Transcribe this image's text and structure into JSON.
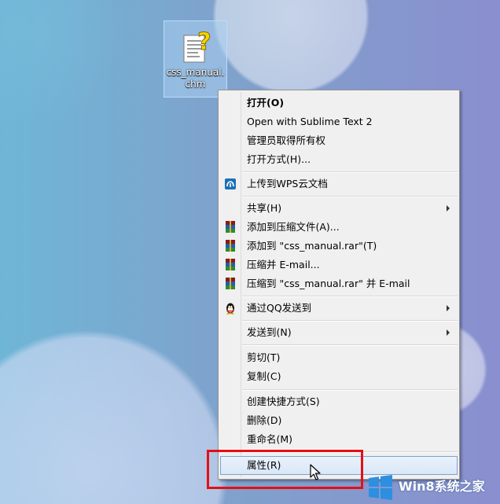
{
  "desktop": {
    "file_icon_name": "chm-help-file-icon",
    "file_label": "css_manual.chm"
  },
  "context_menu": {
    "open": "打开(O)",
    "open_with_sublime": "Open with Sublime Text 2",
    "take_ownership": "管理员取得所有权",
    "open_with": "打开方式(H)...",
    "upload_wps": "上传到WPS云文档",
    "share": "共享(H)",
    "add_to_archive": "添加到压缩文件(A)...",
    "add_to_rar": "添加到 \"css_manual.rar\"(T)",
    "compress_email": "压缩并 E-mail...",
    "compress_rar_email": "压缩到 \"css_manual.rar\" 并 E-mail",
    "send_via_qq": "通过QQ发送到",
    "send_to": "发送到(N)",
    "cut": "剪切(T)",
    "copy": "复制(C)",
    "create_shortcut": "创建快捷方式(S)",
    "delete": "删除(D)",
    "rename": "重命名(M)",
    "properties": "属性(R)"
  },
  "colors": {
    "highlight_box": "#e60f14",
    "menu_background": "#f0f0f0",
    "hover_border": "#7da2ce"
  },
  "watermark": {
    "text": "Win8系统之家"
  }
}
